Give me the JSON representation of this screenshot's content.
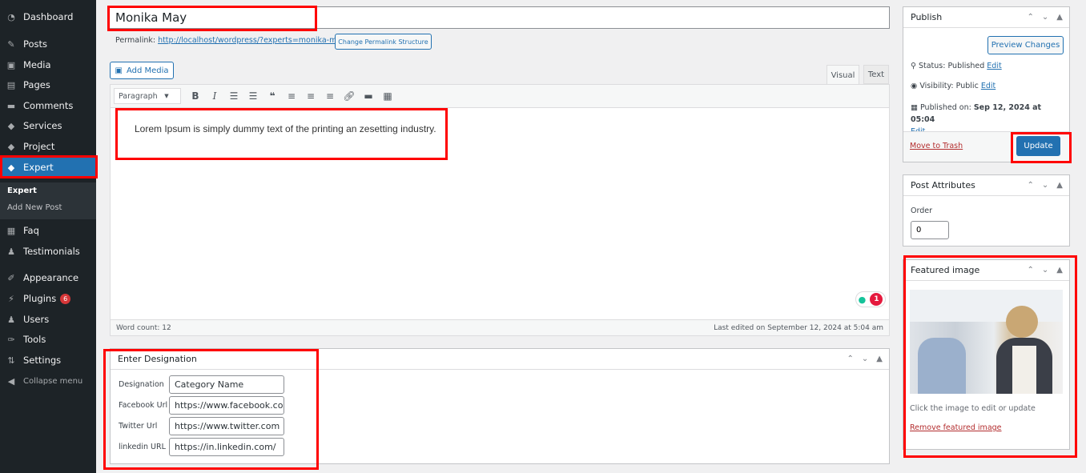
{
  "sidebar": {
    "items": [
      {
        "label": "Dashboard",
        "icon": "dashboard-icon",
        "glyph": "◔"
      },
      {
        "label": "Posts",
        "icon": "pin-icon",
        "glyph": "✎"
      },
      {
        "label": "Media",
        "icon": "media-icon",
        "glyph": "▣"
      },
      {
        "label": "Pages",
        "icon": "pages-icon",
        "glyph": "▤"
      },
      {
        "label": "Comments",
        "icon": "comment-icon",
        "glyph": "▬"
      },
      {
        "label": "Services",
        "icon": "tag-icon",
        "glyph": "◆"
      },
      {
        "label": "Project",
        "icon": "tag-icon",
        "glyph": "◆"
      },
      {
        "label": "Expert",
        "icon": "tag-icon",
        "glyph": "◆"
      },
      {
        "label": "Faq",
        "icon": "faq-icon",
        "glyph": "▦"
      },
      {
        "label": "Testimonials",
        "icon": "user-icon",
        "glyph": "♟"
      },
      {
        "label": "Appearance",
        "icon": "brush-icon",
        "glyph": "✐"
      },
      {
        "label": "Plugins",
        "icon": "plugin-icon",
        "glyph": "⚡",
        "badge": "6"
      },
      {
        "label": "Users",
        "icon": "users-icon",
        "glyph": "♟"
      },
      {
        "label": "Tools",
        "icon": "wrench-icon",
        "glyph": "✑"
      },
      {
        "label": "Settings",
        "icon": "settings-icon",
        "glyph": "⇅"
      },
      {
        "label": "Collapse menu",
        "icon": "collapse-icon",
        "glyph": "◀"
      }
    ],
    "submenu": [
      "Expert",
      "Add New Post"
    ]
  },
  "editor": {
    "title": "Monika May",
    "permalink_label": "Permalink:",
    "permalink_url": "http://localhost/wordpress/?experts=monika-may",
    "change_permalink": "Change Permalink Structure",
    "add_media": "Add Media",
    "tab_visual": "Visual",
    "tab_text": "Text",
    "format_select": "Paragraph",
    "content": "Lorem Ipsum is simply dummy text of the printing an zesetting industry.",
    "grammarly_count": "1",
    "word_count": "Word count: 12",
    "last_edited": "Last edited on September 12, 2024 at 5:04 am"
  },
  "designation": {
    "title": "Enter Designation",
    "fields": [
      {
        "label": "Designation",
        "value": "Category Name"
      },
      {
        "label": "Facebook Url",
        "value": "https://www.facebook.com"
      },
      {
        "label": "Twitter Url",
        "value": "https://www.twitter.com"
      },
      {
        "label": "linkedin URL",
        "value": "https://in.linkedin.com/"
      }
    ]
  },
  "publish": {
    "title": "Publish",
    "preview": "Preview Changes",
    "status_label": "Status:",
    "status_value": "Published",
    "visibility_label": "Visibility:",
    "visibility_value": "Public",
    "published_label": "Published on:",
    "published_value": "Sep 12, 2024 at 05:04",
    "edit": "Edit",
    "trash": "Move to Trash",
    "update": "Update"
  },
  "attributes": {
    "title": "Post Attributes",
    "order_label": "Order",
    "order_value": "0"
  },
  "featured": {
    "title": "Featured image",
    "hint": "Click the image to edit or update",
    "remove": "Remove featured image"
  }
}
